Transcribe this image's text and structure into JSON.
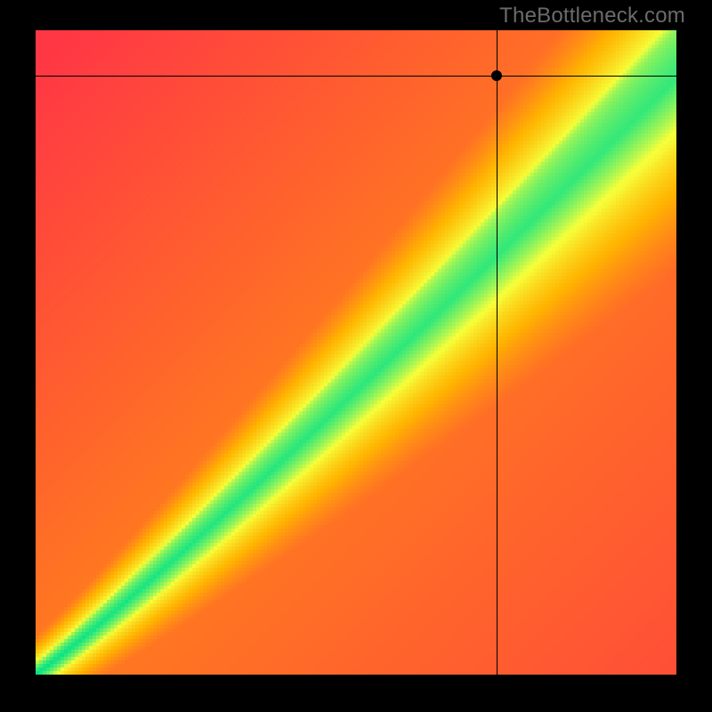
{
  "watermark": "TheBottleneck.com",
  "chart_data": {
    "type": "heatmap",
    "title": "",
    "xlabel": "",
    "ylabel": "",
    "xlim": [
      0,
      100
    ],
    "ylim": [
      0,
      100
    ],
    "axis_ticks_visible": false,
    "grid": false,
    "marker": {
      "x": 72,
      "y": 93
    },
    "crosshair": {
      "x": 72,
      "y": 93
    },
    "optimal_band": {
      "description": "green band where GPU ≈ CPU; widens toward high end",
      "center_line": [
        {
          "x": 0,
          "y": 0
        },
        {
          "x": 20,
          "y": 15
        },
        {
          "x": 40,
          "y": 34
        },
        {
          "x": 60,
          "y": 55
        },
        {
          "x": 80,
          "y": 75
        },
        {
          "x": 100,
          "y": 90
        }
      ],
      "half_width_pct": {
        "low_end": 2,
        "high_end": 10
      }
    },
    "color_stops": [
      {
        "ratio": 0.0,
        "color": "#ff2b4b",
        "meaning": "severe bottleneck"
      },
      {
        "ratio": 0.45,
        "color": "#ffb300",
        "meaning": "moderate bottleneck"
      },
      {
        "ratio": 0.8,
        "color": "#f6ff3a",
        "meaning": "slight bottleneck"
      },
      {
        "ratio": 1.0,
        "color": "#00e28a",
        "meaning": "balanced"
      }
    ],
    "legend": null
  }
}
